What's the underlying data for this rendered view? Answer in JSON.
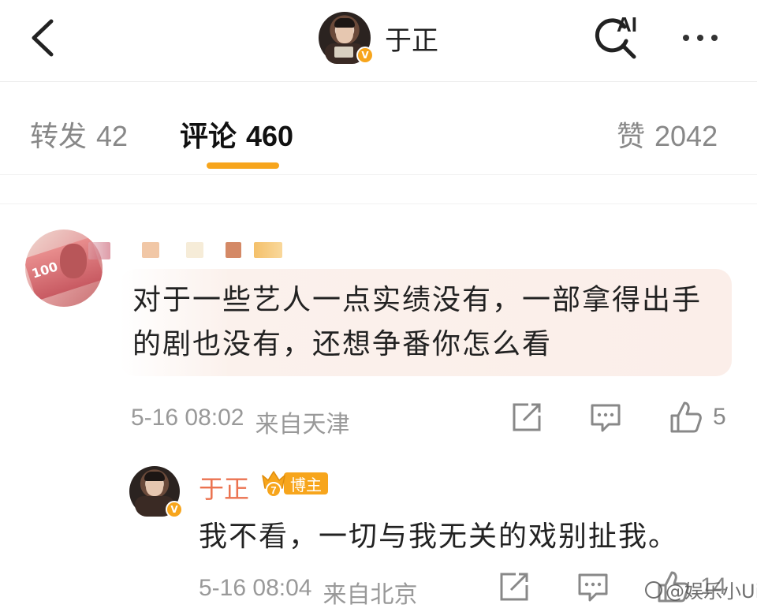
{
  "header": {
    "back_icon": "chevron-left-icon",
    "username": "于正",
    "ai_search_label": "AI",
    "ai_search_icon": "search-icon",
    "more_icon": "more-dots-icon"
  },
  "tabs": {
    "repost": {
      "label": "转发",
      "count": "42"
    },
    "comment": {
      "label": "评论",
      "count": "460"
    },
    "like": {
      "label": "赞",
      "count": "2042"
    },
    "active": "comment",
    "accent_color": "#f7a51c"
  },
  "comment": {
    "text": "对于一些艺人一点实绩没有，一部拿得出手的剧也没有，还想争番你怎么看",
    "time": "5-16 08:02",
    "location": "来自天津",
    "like_count": "5"
  },
  "reply": {
    "username": "于正",
    "badge": "博主",
    "badge_level": "7",
    "verified_mark": "V",
    "text": "我不看，一切与我无关的戏别扯我。",
    "time": "5-16 08:04",
    "location": "来自北京",
    "like_count": "14",
    "name_color": "#eb7350"
  },
  "watermark": {
    "text": "@娱乐小Uio"
  },
  "avatar_text": {
    "banknote": "100"
  }
}
